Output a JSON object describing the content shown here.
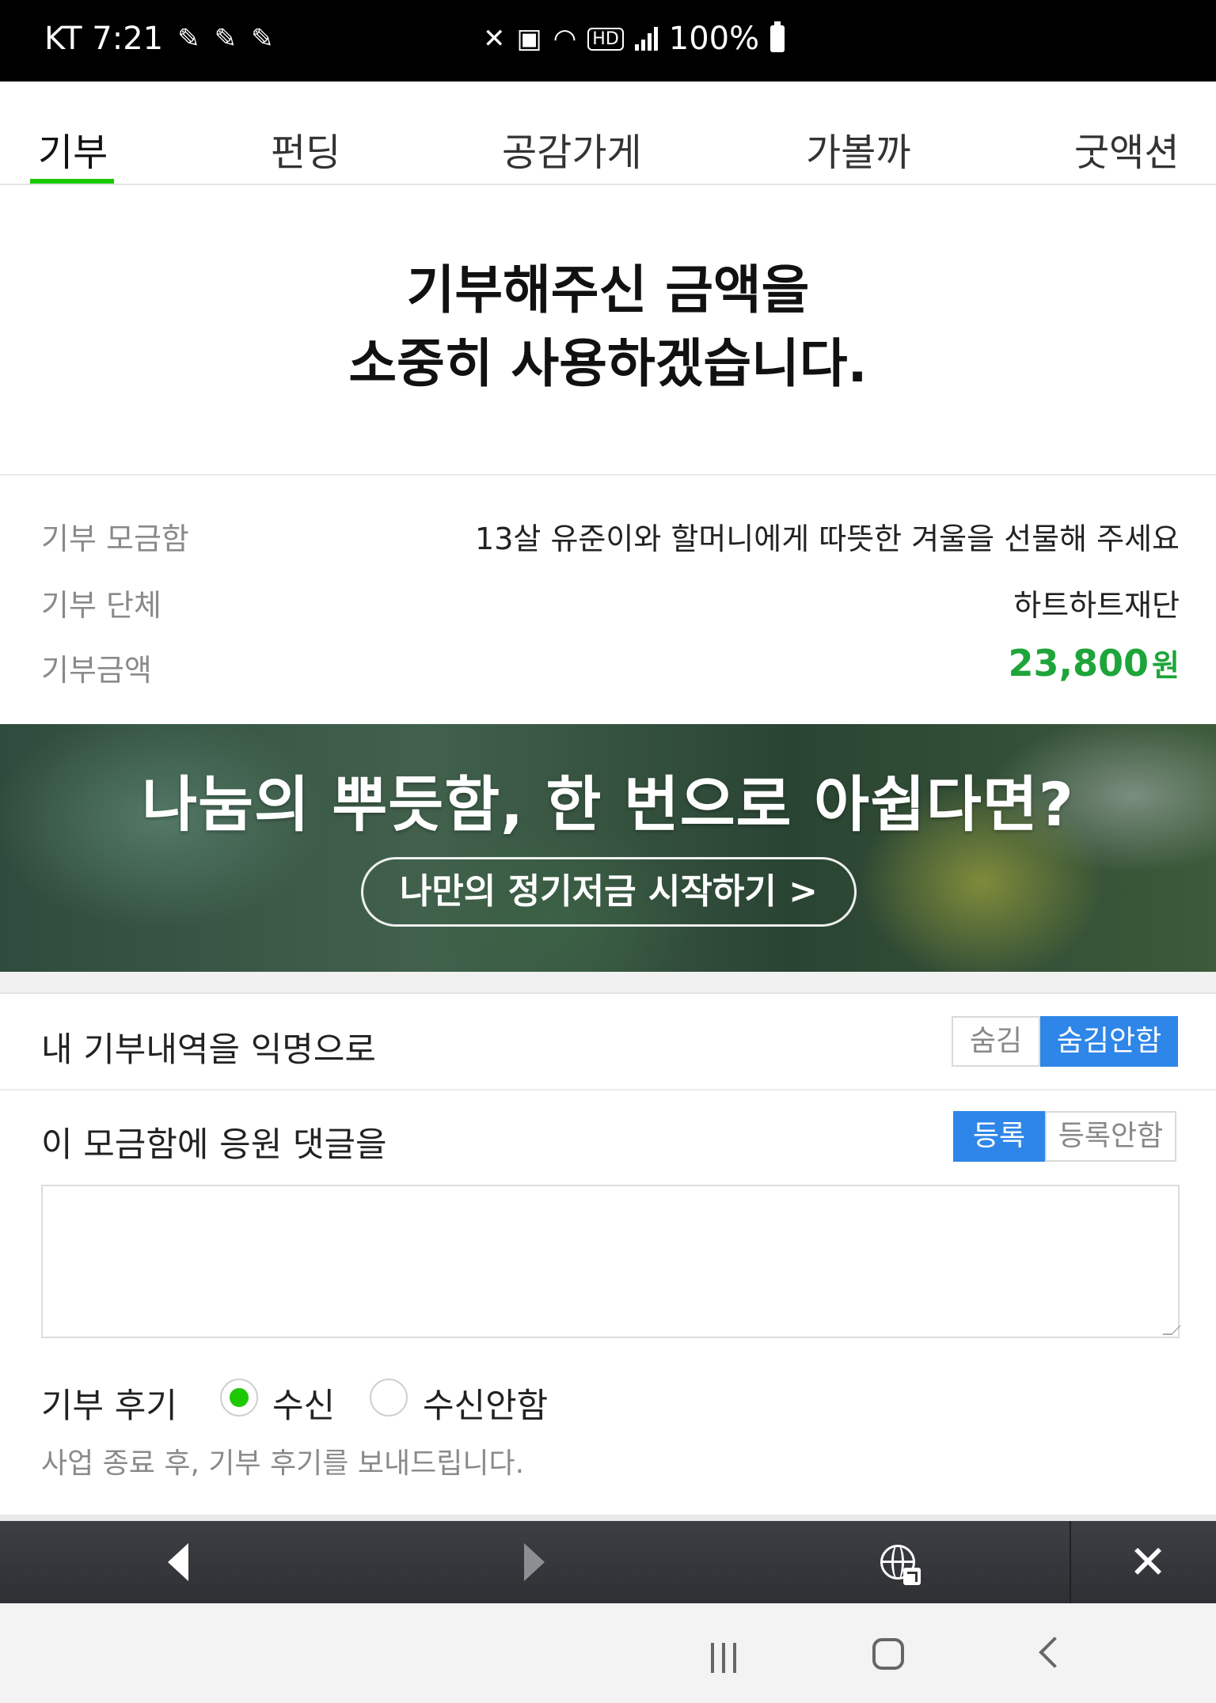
{
  "status_bar": {
    "carrier_time": "KT 7:21",
    "battery": "100%",
    "hd_label": "HD"
  },
  "tabs": [
    {
      "label": "기부",
      "active": true
    },
    {
      "label": "펀딩",
      "active": false
    },
    {
      "label": "공감가게",
      "active": false
    },
    {
      "label": "가볼까",
      "active": false
    },
    {
      "label": "굿액션",
      "active": false
    }
  ],
  "thanks": {
    "line1": "기부해주신 금액을",
    "line2": "소중히 사용하겠습니다."
  },
  "info": {
    "fund_label": "기부 모금함",
    "fund_value": "13살 유준이와 할머니에게 따뜻한 겨울을 선물해 주세요",
    "org_label": "기부 단체",
    "org_value": "하트하트재단",
    "amount_label": "기부금액",
    "amount_value": "23,800",
    "amount_unit": "원"
  },
  "banner": {
    "title": "나눔의 뿌듯함, 한 번으로 아쉽다면?",
    "button": "나만의 정기저금 시작하기 >"
  },
  "anonymous": {
    "label": "내 기부내역을 익명으로",
    "options": [
      "숨김",
      "숨김안함"
    ],
    "selected": "숨김안함"
  },
  "comment": {
    "label": "이 모금함에 응원 댓글을",
    "options": [
      "등록",
      "등록안함"
    ],
    "selected": "등록",
    "value": "",
    "placeholder": ""
  },
  "review": {
    "label": "기부 후기",
    "options": [
      "수신",
      "수신안함"
    ],
    "selected": "수신",
    "note": "사업 종료 후, 기부 후기를 보내드립니다."
  },
  "toolbar": {
    "close": "✕"
  },
  "colors": {
    "accent_green": "#1ec800",
    "amount_green": "#1ea53a",
    "toggle_blue": "#2e86e8"
  }
}
